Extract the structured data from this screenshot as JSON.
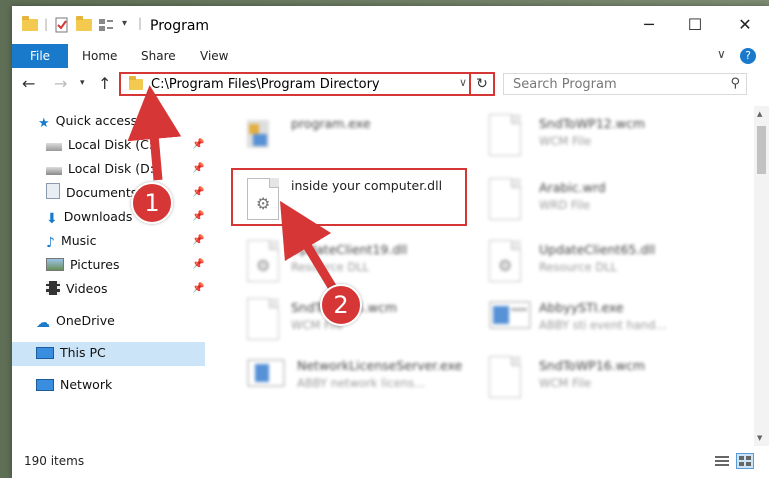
{
  "window": {
    "title": "Program",
    "minimize_glyph": "─",
    "maximize_glyph": "☐",
    "close_glyph": "✕"
  },
  "ribbon": {
    "tabs": [
      "File",
      "Home",
      "Share",
      "View"
    ],
    "expand_glyph": "∨",
    "help_glyph": "?"
  },
  "address": {
    "path": "C:\\Program Files\\Program Directory",
    "search_placeholder": "Search Program"
  },
  "nav": {
    "quick_access": "Quick access",
    "items": [
      "Local Disk (C:)",
      "Local Disk (D:)",
      "Documents",
      "Downloads",
      "Music",
      "Pictures",
      "Videos"
    ],
    "onedrive": "OneDrive",
    "this_pc": "This PC",
    "network": "Network"
  },
  "files": [
    {
      "name": "program.exe",
      "type": ""
    },
    {
      "name": "SndToWP12.wcm",
      "type": "WCM File"
    },
    {
      "name": "inside your computer.dll",
      "type": ""
    },
    {
      "name": "Arabic.wrd",
      "type": "WRD File"
    },
    {
      "name": "UpdateClient19.dll",
      "type": "Resource DLL"
    },
    {
      "name": "UpdateClient65.dll",
      "type": "Resource DLL"
    },
    {
      "name": "SndToWP15.wcm",
      "type": "WCM File"
    },
    {
      "name": "AbbyySTI.exe",
      "type": "ABBY sti event hand..."
    },
    {
      "name": "NetworkLicenseServer.exe",
      "type": "ABBY network licens..."
    },
    {
      "name": "SndToWP16.wcm",
      "type": "WCM File"
    }
  ],
  "status": {
    "item_count": "190 items"
  },
  "annotations": {
    "step1": "1",
    "step2": "2"
  },
  "colors": {
    "accent": "#1979ca",
    "highlight": "#d63636",
    "selection": "#cce4f7"
  }
}
